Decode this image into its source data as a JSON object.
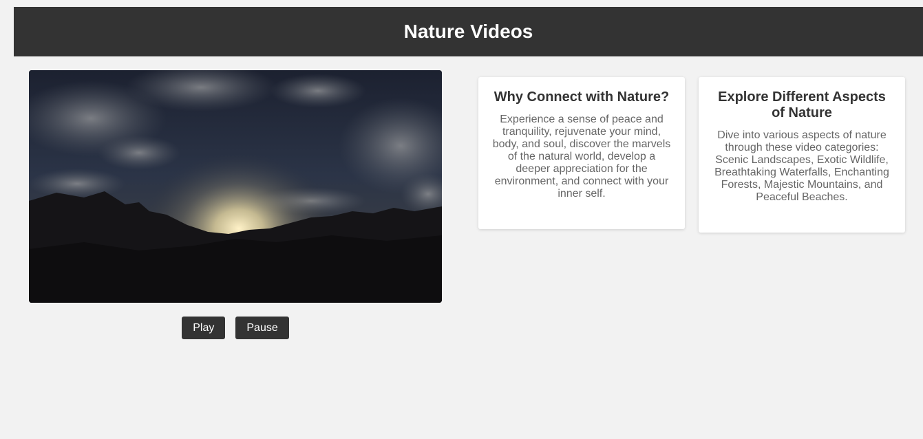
{
  "header": {
    "title": "Nature Videos"
  },
  "video": {
    "controls": {
      "play_label": "Play",
      "pause_label": "Pause"
    }
  },
  "cards": [
    {
      "title": "Why Connect with Nature?",
      "body": "Experience a sense of peace and tranquility, rejuvenate your mind, body, and soul, discover the marvels of the natural world, develop a deeper appreciation for the environment, and connect with your inner self."
    },
    {
      "title": "Explore Different Aspects of Nature",
      "body": "Dive into various aspects of nature through these video categories: Scenic Landscapes, Exotic Wildlife, Breathtaking Waterfalls, Enchanting Forests, Majestic Mountains, and Peaceful Beaches."
    }
  ],
  "colors": {
    "header_bg": "#333333",
    "page_bg": "#f2f2f2",
    "button_bg": "#333333",
    "card_bg": "#ffffff",
    "heading_text": "#333333",
    "body_text": "#666666"
  }
}
